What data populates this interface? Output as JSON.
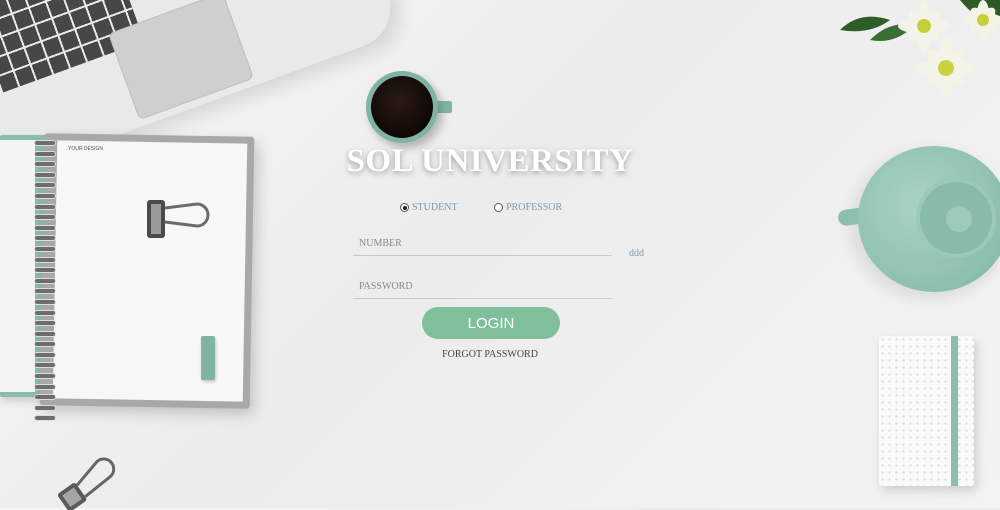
{
  "app": {
    "title": "SOL UNIVERSITY"
  },
  "login": {
    "role_options": [
      {
        "label": "STUDENT",
        "selected": true
      },
      {
        "label": "PROFESSOR",
        "selected": false
      }
    ],
    "number_placeholder": "NUMBER",
    "password_placeholder": "PASSWORD",
    "side_note": "ddd",
    "login_label": "LOGIN",
    "forgot_label": "FORGOT PASSWORD"
  },
  "notebook": {
    "tiny_text": "YOUR DESIGN"
  },
  "colors": {
    "accent": "#7fbf9c",
    "teal": "#8cbfaf",
    "label_blue": "#7d9bb0"
  },
  "icons": [
    "paper-clip-icon",
    "coffee-cup",
    "teapot",
    "flowers"
  ]
}
